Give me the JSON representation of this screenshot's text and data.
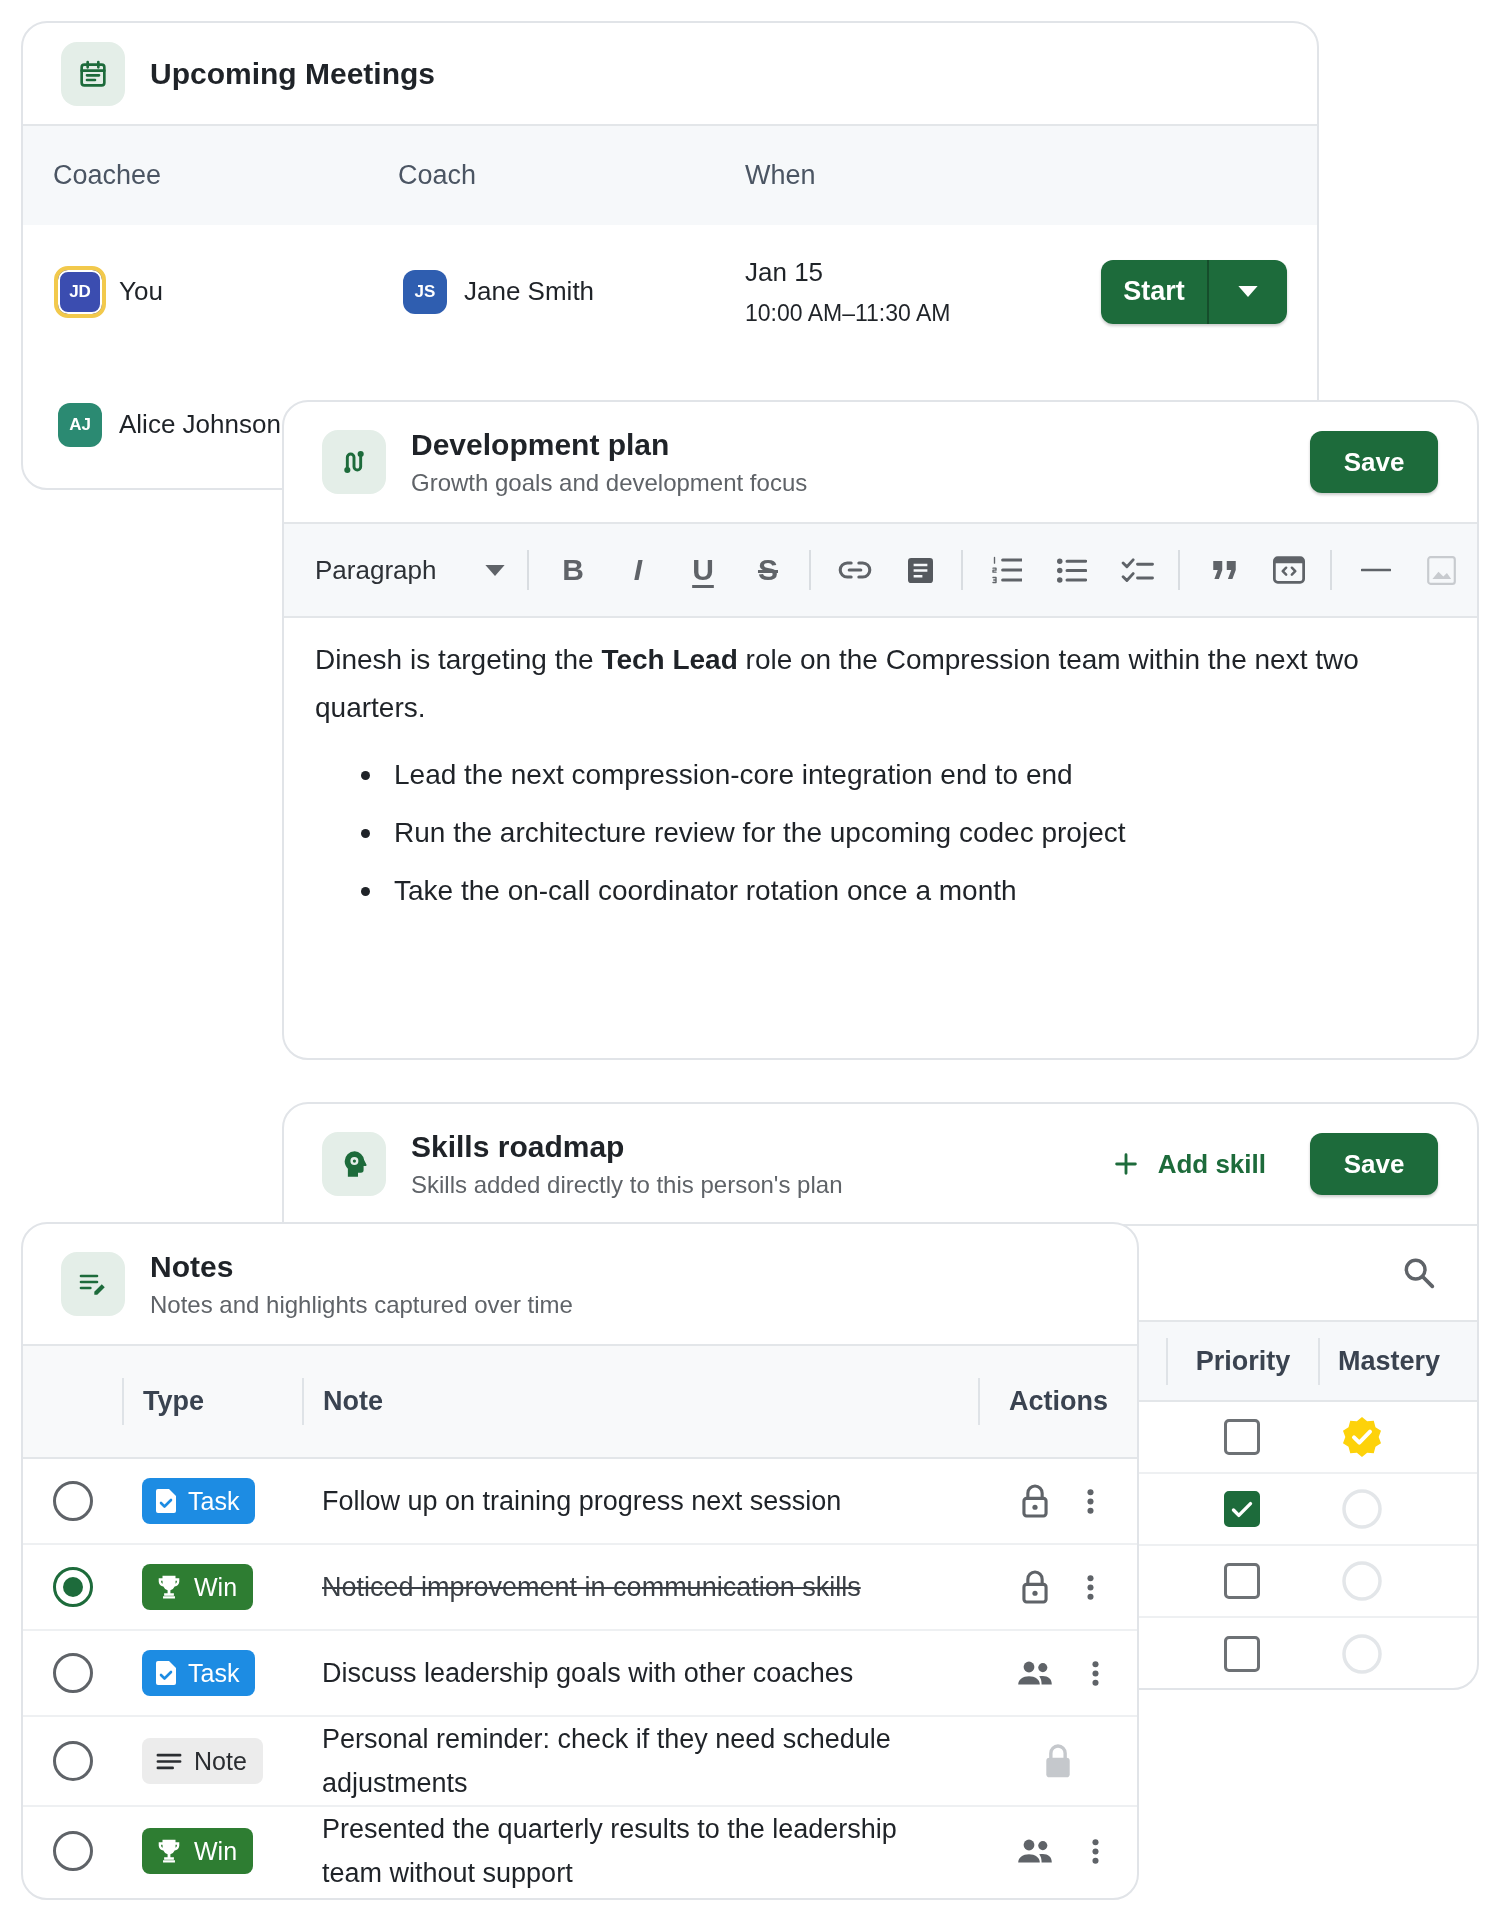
{
  "meetings": {
    "title": "Upcoming Meetings",
    "columns": [
      "Coachee",
      "Coach",
      "When"
    ],
    "rows": [
      {
        "coachee": {
          "initials": "JD",
          "name": "You",
          "color": "#3b4db0",
          "highlighted": true
        },
        "coach": {
          "initials": "JS",
          "name": "Jane Smith",
          "color": "#2f5eb0"
        },
        "date": "Jan 15",
        "time": "10:00 AM–11:30 AM",
        "action": "Start"
      },
      {
        "coachee": {
          "initials": "AJ",
          "name": "Alice Johnson",
          "color": "#2b8a72",
          "highlighted": false
        }
      }
    ]
  },
  "development_plan": {
    "title": "Development plan",
    "subtitle": "Growth goals and development focus",
    "save": "Save",
    "toolbar": {
      "block_style": "Paragraph",
      "groups": [
        [
          {
            "kind": "bold",
            "glyph": "B",
            "disabled": false
          },
          {
            "kind": "italic",
            "glyph": "I",
            "disabled": false
          },
          {
            "kind": "underline",
            "glyph": "U",
            "disabled": false
          },
          {
            "kind": "strike",
            "glyph": "S",
            "disabled": false
          }
        ],
        [
          {
            "kind": "link",
            "disabled": false
          },
          {
            "kind": "block",
            "disabled": false
          }
        ],
        [
          {
            "kind": "ordered",
            "disabled": false
          },
          {
            "kind": "bullets",
            "disabled": false
          },
          {
            "kind": "checklist",
            "disabled": false
          }
        ],
        [
          {
            "kind": "quote",
            "disabled": false
          },
          {
            "kind": "embed",
            "disabled": false
          }
        ],
        [
          {
            "kind": "rule",
            "disabled": false
          },
          {
            "kind": "image",
            "disabled": true
          }
        ]
      ]
    },
    "content": {
      "paragraph": "Dinesh is targeting the **Tech Lead** role on the Compression team within the next two quarters.",
      "bullets": [
        "Lead the next compression-core integration end to end",
        "Run the architecture review for the upcoming codec project",
        "Take the on-call coordinator rotation once a month"
      ]
    }
  },
  "skills_roadmap": {
    "title": "Skills roadmap",
    "subtitle": "Skills added directly to this person's plan",
    "add": "Add skill",
    "save": "Save",
    "columns": [
      "Priority",
      "Mastery"
    ],
    "rows": [
      {
        "priority": false,
        "mastered": true
      },
      {
        "priority": true,
        "mastered": false
      },
      {
        "priority": false,
        "mastered": false
      },
      {
        "priority": false,
        "mastered": false
      }
    ]
  },
  "notes": {
    "title": "Notes",
    "subtitle": "Notes and highlights captured over time",
    "columns": [
      "Type",
      "Note",
      "Actions"
    ],
    "rows": [
      {
        "selected": false,
        "type": {
          "kind": "task",
          "label": "Task"
        },
        "text": "Follow up on training progress next session",
        "done": false,
        "shared": false,
        "locked": false
      },
      {
        "selected": true,
        "type": {
          "kind": "win",
          "label": "Win"
        },
        "text": "Noticed improvement in communication skills",
        "done": true,
        "shared": false,
        "locked": false
      },
      {
        "selected": false,
        "type": {
          "kind": "task",
          "label": "Task"
        },
        "text": "Discuss leadership goals with other coaches",
        "done": false,
        "shared": true,
        "locked": false
      },
      {
        "selected": false,
        "type": {
          "kind": "note",
          "label": "Note"
        },
        "text": "Personal reminder: check if they need schedule adjustments",
        "done": false,
        "shared": false,
        "locked": true
      },
      {
        "selected": false,
        "type": {
          "kind": "win",
          "label": "Win"
        },
        "text": "Presented the quarterly results to the leadership team without support",
        "done": false,
        "shared": true,
        "locked": false
      }
    ]
  }
}
